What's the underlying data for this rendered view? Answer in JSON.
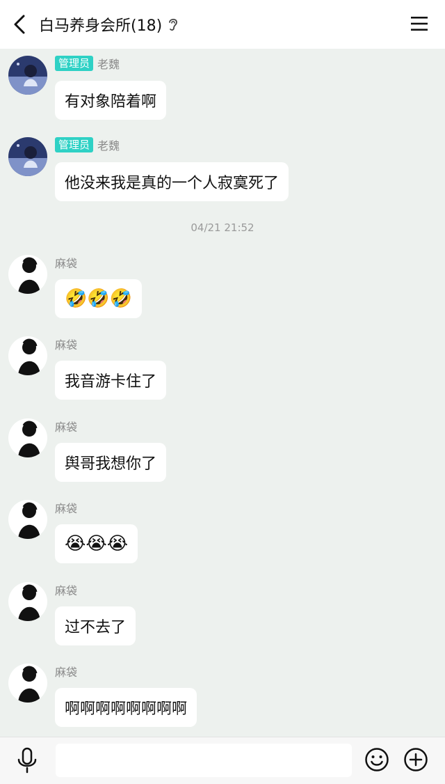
{
  "header": {
    "title": "白马养身会所(18)",
    "back_icon": "chevron-left-icon",
    "ear_icon": "ear-icon",
    "menu_icon": "hamburger-menu-icon"
  },
  "colors": {
    "background": "#edf1ee",
    "badge": "#2fd1c5",
    "bubble": "#ffffff"
  },
  "messages": [
    {
      "badge": "管理员",
      "sender": "老魏",
      "text": "有对象陪着啊",
      "avatar": "anime-girl-avatar"
    },
    {
      "badge": "管理员",
      "sender": "老魏",
      "text": "他没来我是真的一个人寂寞死了",
      "avatar": "anime-girl-avatar"
    },
    {
      "timestamp": "04/21 21:52"
    },
    {
      "sender": "麻袋",
      "text": "🤣🤣🤣",
      "avatar": "dark-silhouette-avatar"
    },
    {
      "sender": "麻袋",
      "text": "我音游卡住了",
      "avatar": "dark-silhouette-avatar"
    },
    {
      "sender": "麻袋",
      "text": "舆哥我想你了",
      "avatar": "dark-silhouette-avatar"
    },
    {
      "sender": "麻袋",
      "text": "😭😭😭",
      "avatar": "dark-silhouette-avatar"
    },
    {
      "sender": "麻袋",
      "text": "过不去了",
      "avatar": "dark-silhouette-avatar"
    },
    {
      "sender": "麻袋",
      "text": "啊啊啊啊啊啊啊啊",
      "avatar": "dark-silhouette-avatar"
    }
  ],
  "input_bar": {
    "mic_icon": "microphone-icon",
    "input_value": "",
    "emoji_icon": "smiley-icon",
    "plus_icon": "plus-circle-icon"
  }
}
